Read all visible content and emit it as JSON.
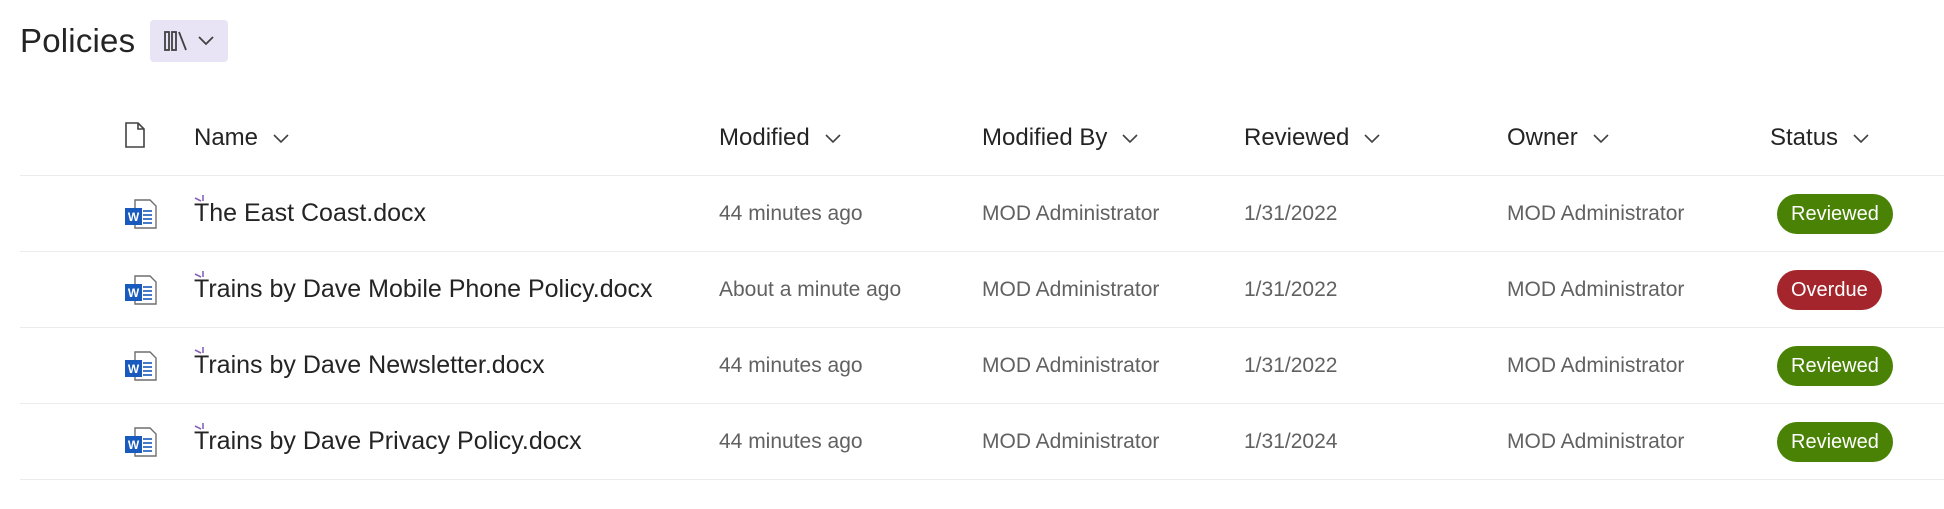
{
  "page": {
    "title": "Policies",
    "view_switcher_icon": "library-icon"
  },
  "columns": {
    "type_icon": "document-icon",
    "name": "Name",
    "modified": "Modified",
    "modified_by": "Modified By",
    "reviewed": "Reviewed",
    "owner": "Owner",
    "status": "Status"
  },
  "rows": [
    {
      "name": "The East Coast.docx",
      "modified": "44 minutes ago",
      "modified_by": "MOD Administrator",
      "reviewed": "1/31/2022",
      "owner": "MOD Administrator",
      "status": "Reviewed",
      "status_color": "#498205"
    },
    {
      "name": "Trains by Dave Mobile Phone Policy.docx",
      "modified": "About a minute ago",
      "modified_by": "MOD Administrator",
      "reviewed": "1/31/2022",
      "owner": "MOD Administrator",
      "status": "Overdue",
      "status_color": "#a4262c"
    },
    {
      "name": "Trains by Dave Newsletter.docx",
      "modified": "44 minutes ago",
      "modified_by": "MOD Administrator",
      "reviewed": "1/31/2022",
      "owner": "MOD Administrator",
      "status": "Reviewed",
      "status_color": "#498205"
    },
    {
      "name": "Trains by Dave Privacy Policy.docx",
      "modified": "44 minutes ago",
      "modified_by": "MOD Administrator",
      "reviewed": "1/31/2024",
      "owner": "MOD Administrator",
      "status": "Reviewed",
      "status_color": "#498205"
    }
  ],
  "colors": {
    "accent": "#8764b8",
    "view_switcher_bg": "#e8e3f5",
    "word_blue": "#185abd"
  }
}
